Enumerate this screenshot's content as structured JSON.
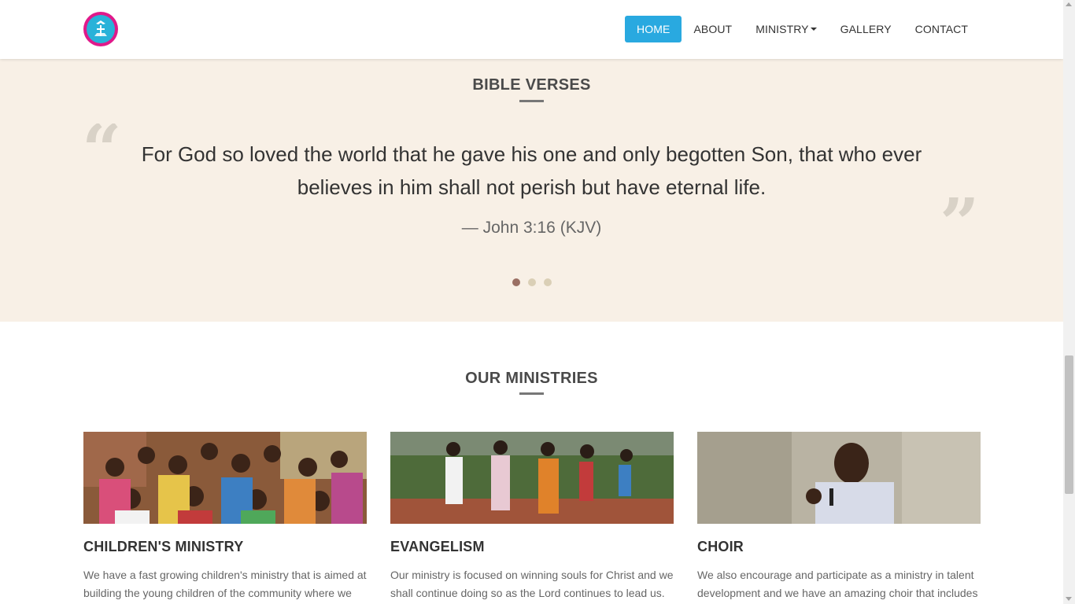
{
  "header": {
    "logo_icon": "church-logo-icon",
    "nav": [
      {
        "label": "HOME",
        "active": true
      },
      {
        "label": "ABOUT",
        "active": false
      },
      {
        "label": "MINISTRY",
        "active": false,
        "dropdown": true
      },
      {
        "label": "GALLERY",
        "active": false
      },
      {
        "label": "CONTACT",
        "active": false
      }
    ]
  },
  "bible_verses": {
    "title": "BIBLE VERSES",
    "verse": "For God so loved the world that he gave his one and only begotten Son, that who ever believes in him shall not perish but have eternal life.",
    "reference": "— John 3:16 (KJV)",
    "carousel": {
      "slides": 3,
      "active_index": 0
    }
  },
  "ministries": {
    "title": "OUR MINISTRIES",
    "items": [
      {
        "title": "CHILDREN'S MINISTRY",
        "text": "We have a fast growing children's ministry that is aimed at building the young children of the community where we",
        "image": "children-group-photo"
      },
      {
        "title": "EVANGELISM",
        "text": "Our ministry is focused on winning souls for Christ and we shall continue doing so as the Lord continues to lead us.",
        "image": "evangelism-outdoor-photo"
      },
      {
        "title": "CHOIR",
        "text": "We also encourage and participate as a ministry in talent development and we have an amazing choir that includes",
        "image": "choir-speaker-photo"
      }
    ]
  },
  "colors": {
    "accent": "#29a9e0",
    "verses_bg": "#f8f0e6",
    "dot_active": "#9a6f63",
    "dot_inactive": "#dacfb6"
  }
}
